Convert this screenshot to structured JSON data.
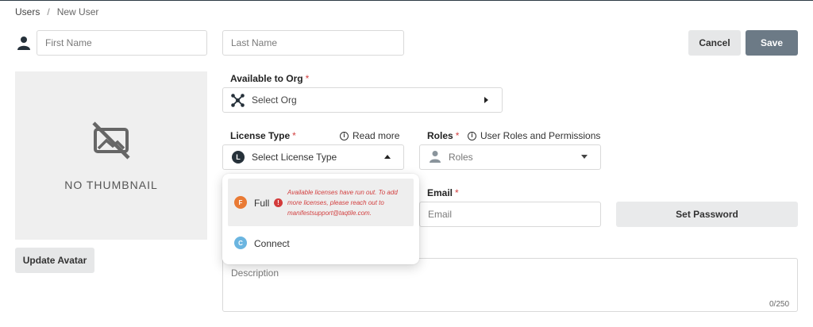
{
  "breadcrumb": {
    "root": "Users",
    "separator": "/",
    "current": "New User"
  },
  "form": {
    "first_name_placeholder": "First Name",
    "last_name_placeholder": "Last Name",
    "cancel_label": "Cancel",
    "save_label": "Save",
    "thumbnail_text": "NO THUMBNAIL",
    "update_avatar_label": "Update Avatar",
    "org_label": "Available to Org",
    "org_placeholder": "Select Org",
    "license_label": "License Type",
    "read_more": "Read more",
    "license_placeholder": "Select License Type",
    "license_badge": "L",
    "roles_label": "Roles",
    "roles_info": "User Roles and Permissions",
    "roles_placeholder": "Roles",
    "email_label": "Email",
    "email_placeholder": "Email",
    "set_password_label": "Set Password",
    "description_placeholder": "Description",
    "description_count": "0/250",
    "required_marker": "*"
  },
  "license_dropdown": {
    "options": [
      {
        "badge": "F",
        "label": "Full",
        "color": "#e97a34",
        "warning": "Available licenses have run out. To add more licenses, please reach out to manifestsupport@taqtile.com."
      },
      {
        "badge": "C",
        "label": "Connect",
        "color": "#6bb5e0"
      }
    ]
  },
  "colors": {
    "save": "#6c7a86",
    "required": "#d23f3f",
    "error": "#d33a3a"
  },
  "icons": [
    "user-icon",
    "no-image-icon",
    "org-icon",
    "info-icon",
    "user-roles-icon",
    "error-icon"
  ]
}
